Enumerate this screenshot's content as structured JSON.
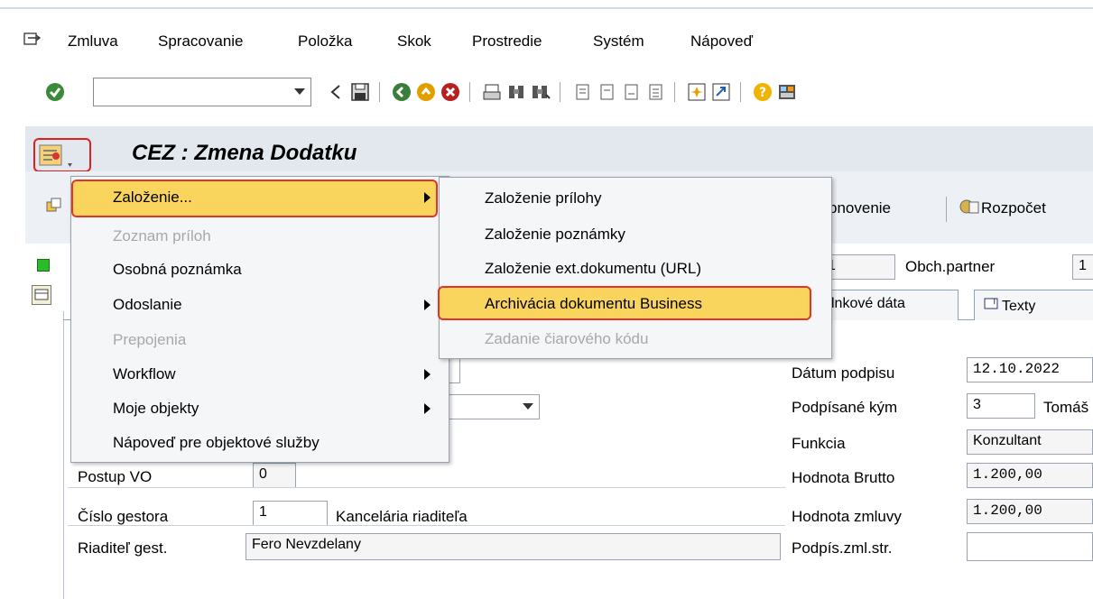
{
  "menubar": {
    "items": [
      "Zmluva",
      "Spracovanie",
      "Položka",
      "Skok",
      "Prostredie",
      "Systém",
      "Nápoveď"
    ]
  },
  "toolbar": {
    "command_value": ""
  },
  "title": "CEZ : Zmena Dodatku",
  "appbar": {
    "obnovenie": "bnovenie",
    "rozpocet": "Rozpočet"
  },
  "header_fields": {
    "field1_value": "1",
    "obch_partner_label": "Obch.partner",
    "obch_partner_value": "1"
  },
  "tabs": {
    "linkove_data": "lnkové dáta",
    "texty": "Texty"
  },
  "context_menu": {
    "items": [
      {
        "label": "Založenie...",
        "enabled": true,
        "submenu": true,
        "highlighted": true
      },
      {
        "label": "Zoznam príloh",
        "enabled": false
      },
      {
        "label": "Osobná poznámka",
        "enabled": true
      },
      {
        "label": "Odoslanie",
        "enabled": true,
        "submenu": true
      },
      {
        "label": "Prepojenia",
        "enabled": false
      },
      {
        "label": "Workflow",
        "enabled": true,
        "submenu": true
      },
      {
        "label": "Moje objekty",
        "enabled": true,
        "submenu": true
      },
      {
        "label": "Nápoveď pre objektové služby",
        "enabled": true
      }
    ]
  },
  "submenu": {
    "items": [
      {
        "label": "Založenie prílohy",
        "enabled": true
      },
      {
        "label": "Založenie poznámky",
        "enabled": true
      },
      {
        "label": "Založenie ext.dokumentu (URL)",
        "enabled": true
      },
      {
        "label": "Archivácia dokumentu Business",
        "enabled": true,
        "highlighted": true
      },
      {
        "label": "Zadanie čiarového kódu",
        "enabled": false
      }
    ]
  },
  "form_left": {
    "postup_vo_label": "Postup VO",
    "postup_vo_value": "0",
    "cislo_gestora_label": "Číslo gestora",
    "cislo_gestora_value": "1",
    "cislo_gestora_text": "Kancelária riaditeľa",
    "riaditel_label": "Riaditeľ gest.",
    "riaditel_value": "Fero Nevzdelany"
  },
  "form_right": {
    "datum_podpisu_label": "Dátum podpisu",
    "datum_podpisu_value": "12.10.2022",
    "podpisane_kym_label": "Podpísané kým",
    "podpisane_kym_value": "3",
    "podpisane_kym_name": "Tomáš",
    "funkcia_label": "Funkcia",
    "funkcia_value": "Konzultant",
    "hodnota_brutto_label": "Hodnota Brutto",
    "hodnota_brutto_value": "1.200,00",
    "hodnota_zmluvy_label": "Hodnota zmluvy",
    "hodnota_zmluvy_value": "1.200,00",
    "podpis_zml_label": "Podpís.zml.str.",
    "podpis_zml_value": ""
  },
  "colors": {
    "highlight": "#fad55d",
    "highlight_border": "#e0362a",
    "title_band": "#e3e8ef"
  }
}
